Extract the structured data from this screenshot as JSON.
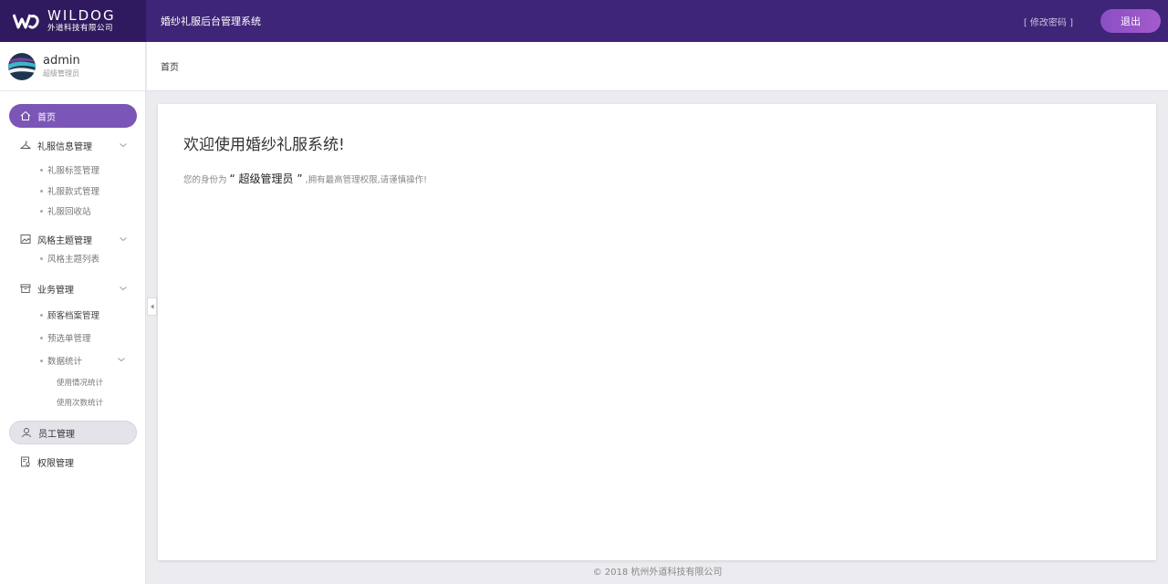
{
  "header": {
    "logo_en": "WILDOG",
    "logo_cn": "外道科技有限公司",
    "system_title": "婚纱礼服后台管理系统",
    "change_password": "[ 修改密码 ]",
    "logout": "退出",
    "bg_color": "#3e2577"
  },
  "user": {
    "name": "admin",
    "role": "超级管理员"
  },
  "sidebar": {
    "home": "首页",
    "dress_info": "礼服信息管理",
    "dress_tag": "礼服标签管理",
    "dress_style": "礼服款式管理",
    "dress_recycle": "礼服回收站",
    "theme": "风格主题管理",
    "theme_list": "风格主题列表",
    "business": "业务管理",
    "customer": "顾客档案管理",
    "preselect": "预选单管理",
    "stats": "数据统计",
    "usage_stats": "使用情况统计",
    "count_stats": "使用次数统计",
    "staff": "员工管理",
    "permission": "权限管理",
    "active_color": "#7b56b6"
  },
  "breadcrumb": "首页",
  "main": {
    "welcome_title": "欢迎使用婚纱礼服系统!",
    "desc_prefix": "您的身份为",
    "desc_role": "“ 超级管理员 ”",
    "desc_suffix": ",拥有最高管理权限,请谨慎操作!"
  },
  "footer": "© 2018 杭州外道科技有限公司"
}
